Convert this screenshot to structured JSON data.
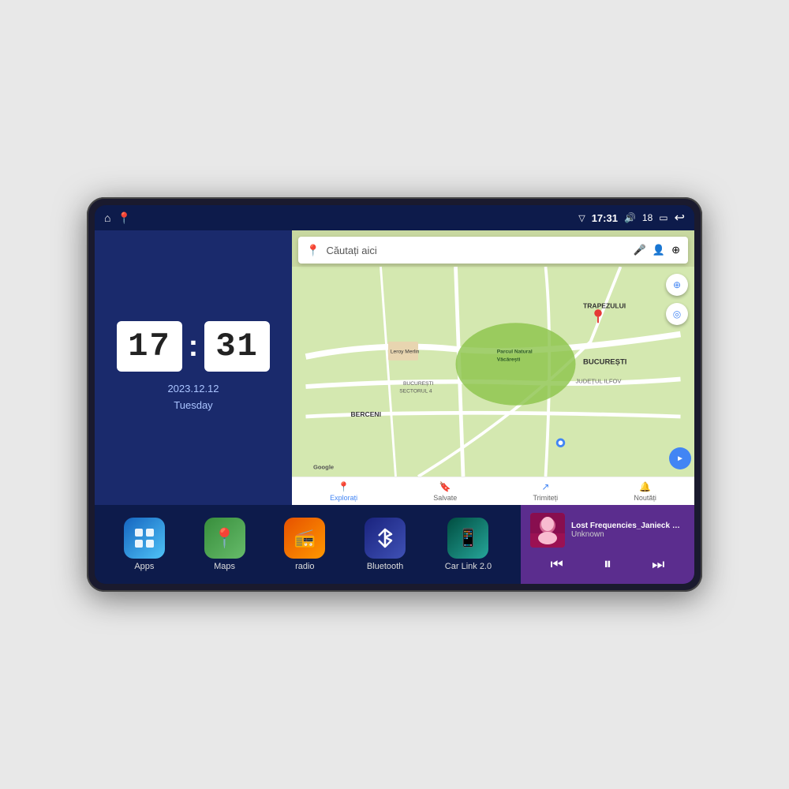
{
  "device": {
    "screen": {
      "status_bar": {
        "left_icons": [
          "home",
          "maps-pin"
        ],
        "time": "17:31",
        "signal": "▽",
        "volume_icon": "🔊",
        "battery_level": "18",
        "battery_icon": "🔋",
        "back_icon": "↩"
      }
    },
    "clock_widget": {
      "hours": "17",
      "minutes": "31",
      "date": "2023.12.12",
      "day": "Tuesday"
    },
    "map_widget": {
      "search_placeholder": "Căutați aici",
      "nav_items": [
        {
          "label": "Explorați",
          "icon": "📍"
        },
        {
          "label": "Salvate",
          "icon": "🔖"
        },
        {
          "label": "Trimiteți",
          "icon": "↗"
        },
        {
          "label": "Noutăți",
          "icon": "🔔"
        }
      ],
      "places": [
        "TRAPEZULUI",
        "BUCUREȘTI",
        "JUDEȚUL ILFOV",
        "BERCENI",
        "Parcul Natural Văcărești",
        "Leroy Merlin",
        "BUCUREȘTI SECTORUL 4"
      ],
      "zoom_in_label": "+",
      "compass_label": "⊕",
      "location_label": "◎",
      "start_label": "START"
    },
    "app_icons": [
      {
        "id": "apps",
        "label": "Apps",
        "icon": "⊞",
        "bg_class": "apps-bg"
      },
      {
        "id": "maps",
        "label": "Maps",
        "icon": "📍",
        "bg_class": "maps-bg"
      },
      {
        "id": "radio",
        "label": "radio",
        "icon": "📻",
        "bg_class": "radio-bg"
      },
      {
        "id": "bluetooth",
        "label": "Bluetooth",
        "icon": "⬡",
        "bg_class": "bt-bg"
      },
      {
        "id": "carlink",
        "label": "Car Link 2.0",
        "icon": "📱",
        "bg_class": "carlink-bg"
      }
    ],
    "music_player": {
      "song_title": "Lost Frequencies_Janieck Devy-...",
      "artist": "Unknown",
      "prev_icon": "⏮",
      "play_icon": "⏸",
      "next_icon": "⏭"
    }
  }
}
